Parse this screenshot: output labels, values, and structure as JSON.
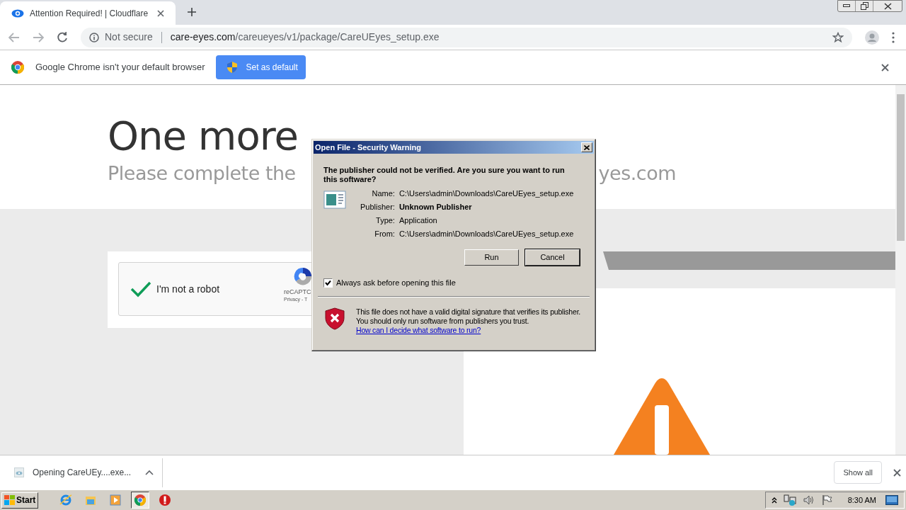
{
  "browser": {
    "tabs": [
      {
        "title": "Attention Required! | Cloudflare",
        "selected": true
      }
    ],
    "address_bar": {
      "security_label": "Not secure",
      "domain": "care-eyes.com",
      "path": "/careueyes/v1/package/CareUEyes_setup.exe"
    }
  },
  "infobar": {
    "message": "Google Chrome isn't your default browser",
    "button": "Set as default"
  },
  "page": {
    "heading": "One more",
    "subtitle_left": "Please complete the",
    "subtitle_right": "yes.com",
    "captcha": {
      "label": "I'm not a robot",
      "checked": true,
      "brand": "reCAPTC",
      "links": "Privacy - T"
    }
  },
  "dialog": {
    "title": "Open File - Security Warning",
    "question": "The publisher could not be verified.  Are you sure you want to run this software?",
    "fields": [
      {
        "label": "Name:",
        "value": "C:\\Users\\admin\\Downloads\\CareUEyes_setup.exe",
        "emphasis": false
      },
      {
        "label": "Publisher:",
        "value": "Unknown Publisher",
        "emphasis": true
      },
      {
        "label": "Type:",
        "value": "Application",
        "emphasis": false
      },
      {
        "label": "From:",
        "value": "C:\\Users\\admin\\Downloads\\CareUEyes_setup.exe",
        "emphasis": false
      }
    ],
    "buttons": [
      {
        "label": "Run",
        "default": false
      },
      {
        "label": "Cancel",
        "default": true
      }
    ],
    "checkbox": {
      "label": "Always ask before opening this file",
      "checked": true
    },
    "warning": "This file does not have a valid digital signature that verifies its publisher.  You should only run software from publishers you trust.",
    "link": "How can I decide what software to run?"
  },
  "download_bar": {
    "item": "Opening CareUEy....exe...",
    "show_all": "Show all"
  },
  "taskbar": {
    "start": "Start",
    "pinned": [
      {
        "kind": "ie",
        "selected": false
      },
      {
        "kind": "explorer",
        "selected": false
      },
      {
        "kind": "media",
        "selected": false
      },
      {
        "kind": "chrome",
        "selected": true
      },
      {
        "kind": "stop",
        "selected": false
      }
    ],
    "clock": "8:30 AM"
  }
}
